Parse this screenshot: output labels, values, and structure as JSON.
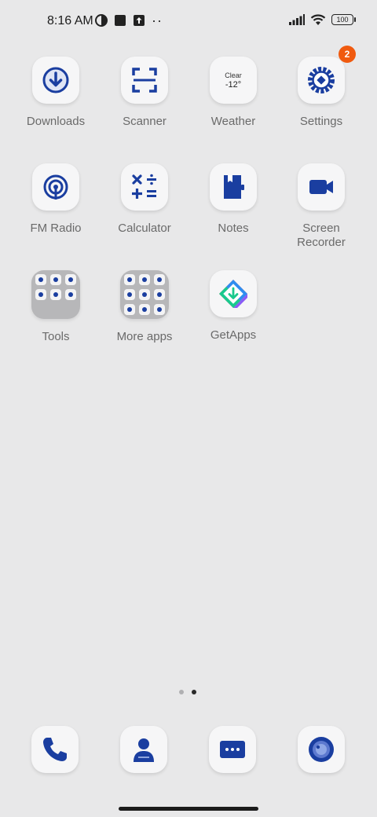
{
  "status_bar": {
    "time": "8:16 AM",
    "battery": "100",
    "icons": [
      "contrast-icon",
      "square-notification-icon",
      "upload-icon",
      "more-icon",
      "signal-icon",
      "wifi-icon",
      "battery-icon"
    ]
  },
  "apps": [
    {
      "label": "Downloads"
    },
    {
      "label": "Scanner"
    },
    {
      "label": "Weather",
      "weather_condition": "Clear",
      "weather_temp": "-12°"
    },
    {
      "label": "Settings",
      "badge": "2"
    },
    {
      "label": "FM Radio"
    },
    {
      "label": "Calculator"
    },
    {
      "label": "Notes"
    },
    {
      "label": "Screen Recorder"
    },
    {
      "label": "Tools"
    },
    {
      "label": "More apps"
    },
    {
      "label": "GetApps"
    }
  ],
  "dock": [
    "phone",
    "contacts",
    "messages",
    "camera"
  ],
  "colors": {
    "background": "#e8e8e9",
    "icon_blue": "#1a3ea0",
    "badge": "#f05a0f",
    "label": "#6a6a6a"
  }
}
